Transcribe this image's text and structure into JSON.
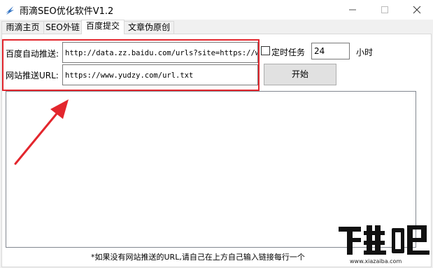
{
  "window": {
    "title": "雨滴SEO优化软件V1.2",
    "icons": [
      "app-logo-icon",
      "minimize-icon",
      "maximize-icon",
      "close-icon"
    ]
  },
  "tabs": [
    {
      "label": "雨滴主页",
      "active": false
    },
    {
      "label": "SEO外链",
      "active": false
    },
    {
      "label": "百度提交",
      "active": true
    },
    {
      "label": "文章伪原创",
      "active": false
    }
  ],
  "form": {
    "auto_push_label": "百度自动推送:",
    "auto_push_value": "http://data.zz.baidu.com/urls?site=https://www",
    "site_url_label": "网站推送URL:",
    "site_url_value": "https://www.yudzy.com/url.txt",
    "timer_label": "定时任务",
    "timer_checked": false,
    "timer_value": "24",
    "timer_unit": "小时",
    "start_label": "开始"
  },
  "output_log": "",
  "hint": "*如果没有网站推送的URL,请自己在上方自己输入链接每行一个",
  "watermark": {
    "logo_text": "下载吧",
    "url": "www.xiazaiba.com"
  },
  "colors": {
    "highlight": "#e3262d",
    "titlebar": "#ffffff",
    "panel": "#ffffff"
  }
}
